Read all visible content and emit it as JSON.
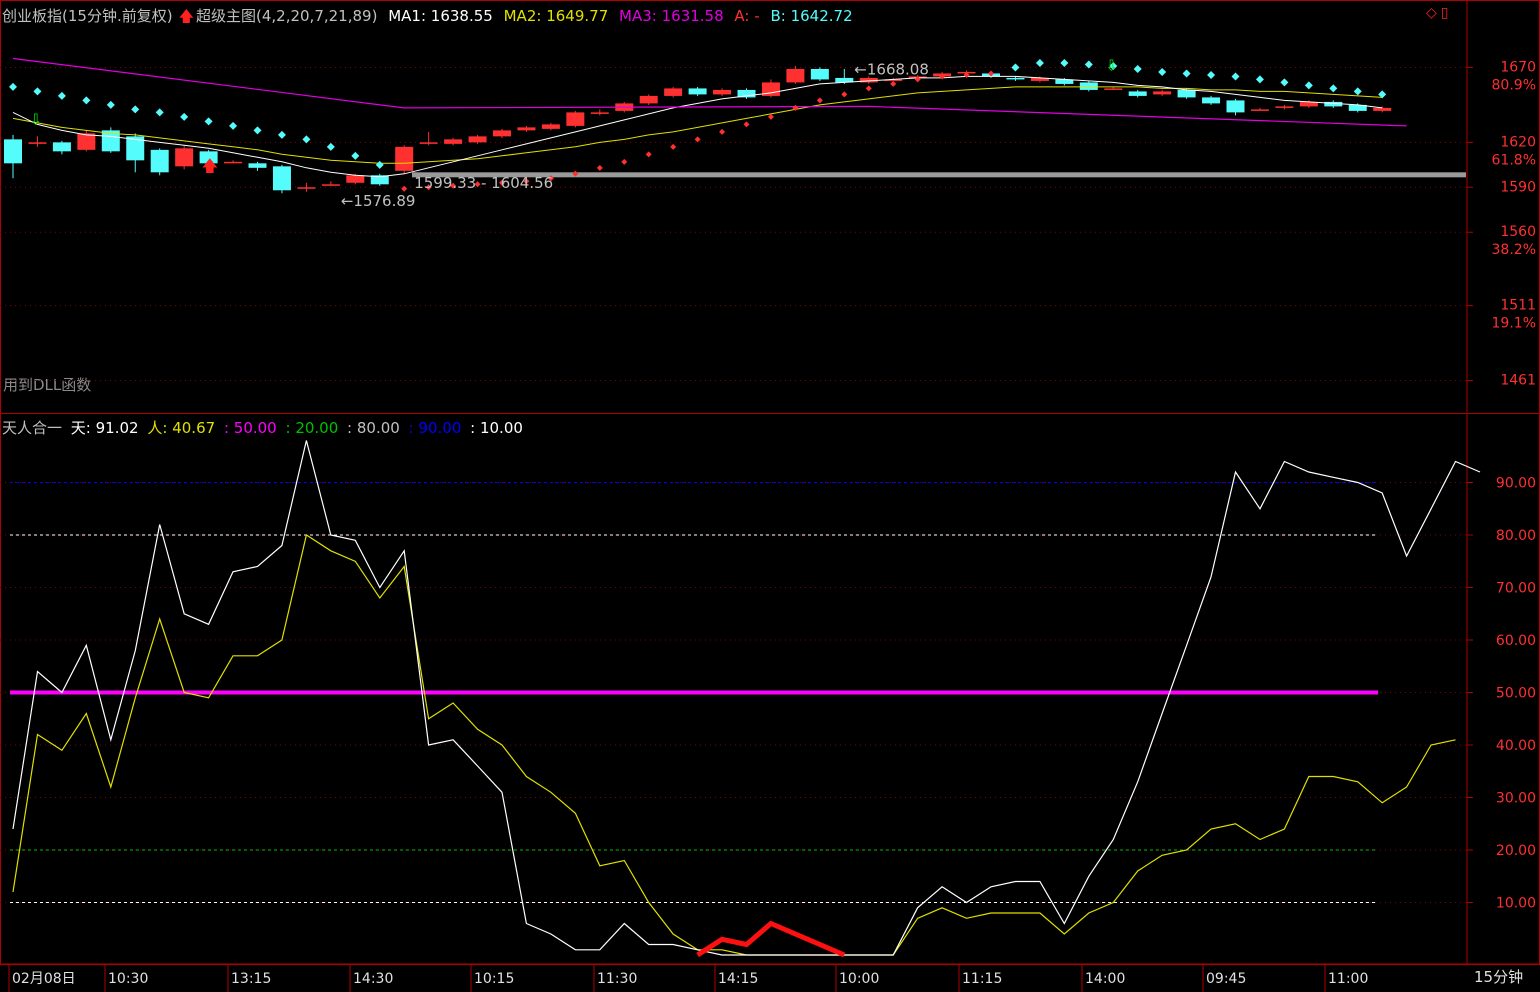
{
  "header": {
    "title": "创业板指(15分钟.前复权)",
    "indicator_name": "超级主图(4,2,20,7,21,89)",
    "ma1_label": "MA1:",
    "ma1_value": "1638.55",
    "ma2_label": "MA2:",
    "ma2_value": "1649.77",
    "ma3_label": "MA3:",
    "ma3_value": "1631.58",
    "a_label": "A: -",
    "b_label": "B:",
    "b_value": "1642.72"
  },
  "dll_note": "用到DLL函数",
  "indicator": {
    "name": "天人合一",
    "tian_label": "天:",
    "tian_value": "91.02",
    "ren_label": "人:",
    "ren_value": "40.67",
    "l50": ": 50.00",
    "l20": ": 20.00",
    "l80": ": 80.00",
    "l90": ": 90.00",
    "l10": ": 10.00"
  },
  "period_label": "15分钟",
  "corner_icons": [
    "diamond-icon",
    "window-icon"
  ],
  "colors": {
    "up": "#ff3030",
    "down": "#54fcfc",
    "ma1": "#ffffff",
    "ma2": "#e0e000",
    "ma3": "#e000e0",
    "tian": "#ffffff",
    "ren": "#e0e000",
    "l50": "#ff00ff",
    "l20": "#00c000",
    "l90": "#0000ff",
    "l80": "#ffffff",
    "l10": "#ffffff"
  },
  "chart_data": [
    {
      "type": "candlestick",
      "title": "创业板指(15分钟.前复权)",
      "ylim": [
        1440,
        1695
      ],
      "y_ticks": [
        {
          "value": 1670,
          "label": "1670",
          "pct": "80.9%"
        },
        {
          "value": 1620,
          "label": "1620",
          "pct": "61.8%"
        },
        {
          "value": 1590,
          "label": "1590",
          "pct": ""
        },
        {
          "value": 1560,
          "label": "1560",
          "pct": "38.2%"
        },
        {
          "value": 1511,
          "label": "1511",
          "pct": "19.1%"
        },
        {
          "value": 1461,
          "label": "1461",
          "pct": ""
        }
      ],
      "candles": [
        [
          1622,
          1606,
          1625,
          1596
        ],
        [
          1620,
          1620,
          1624,
          1617
        ],
        [
          1620,
          1614,
          1621,
          1612
        ],
        [
          1615,
          1626,
          1628,
          1614
        ],
        [
          1628,
          1614,
          1630,
          1613
        ],
        [
          1624,
          1608,
          1626,
          1600
        ],
        [
          1615,
          1600,
          1616,
          1598
        ],
        [
          1604,
          1616,
          1618,
          1602
        ],
        [
          1614,
          1606,
          1615,
          1605
        ],
        [
          1607,
          1607,
          1608,
          1606
        ],
        [
          1606,
          1603,
          1607,
          1601
        ],
        [
          1604,
          1588,
          1605,
          1586
        ],
        [
          1590,
          1590,
          1593,
          1587
        ],
        [
          1592,
          1592,
          1594,
          1591
        ],
        [
          1593,
          1598,
          1599,
          1592
        ],
        [
          1598,
          1592,
          1599,
          1591
        ],
        [
          1601,
          1617,
          1618,
          1599
        ],
        [
          1619,
          1620,
          1627,
          1618
        ],
        [
          1619,
          1622,
          1623,
          1618
        ],
        [
          1620,
          1624,
          1625,
          1619
        ],
        [
          1624,
          1628,
          1629,
          1623
        ],
        [
          1628,
          1630,
          1631,
          1627
        ],
        [
          1629,
          1632,
          1633,
          1628
        ],
        [
          1631,
          1640,
          1641,
          1630
        ],
        [
          1640,
          1640,
          1642,
          1638
        ],
        [
          1641,
          1646,
          1647,
          1640
        ],
        [
          1646,
          1651,
          1652,
          1645
        ],
        [
          1651,
          1656,
          1657,
          1650
        ],
        [
          1656,
          1652,
          1657,
          1651
        ],
        [
          1652,
          1655,
          1656,
          1651
        ],
        [
          1655,
          1650,
          1656,
          1649
        ],
        [
          1651,
          1660,
          1662,
          1650
        ],
        [
          1660,
          1669,
          1671,
          1659
        ],
        [
          1669,
          1662,
          1670,
          1661
        ],
        [
          1663,
          1660,
          1669,
          1659
        ],
        [
          1660,
          1663,
          1664,
          1659
        ],
        [
          1662,
          1662,
          1663,
          1661
        ],
        [
          1664,
          1664,
          1665,
          1663
        ],
        [
          1664,
          1666,
          1667,
          1663
        ],
        [
          1666,
          1667,
          1668,
          1665
        ],
        [
          1666,
          1664,
          1667,
          1663
        ],
        [
          1663,
          1662,
          1664,
          1661
        ],
        [
          1661,
          1663,
          1664,
          1660
        ],
        [
          1662,
          1659,
          1663,
          1658
        ],
        [
          1660,
          1655,
          1661,
          1654
        ],
        [
          1656,
          1656,
          1657,
          1655
        ],
        [
          1654,
          1651,
          1655,
          1650
        ],
        [
          1652,
          1654,
          1655,
          1651
        ],
        [
          1655,
          1650,
          1656,
          1649
        ],
        [
          1650,
          1646,
          1651,
          1645
        ],
        [
          1648,
          1640,
          1649,
          1638
        ],
        [
          1642,
          1642,
          1643,
          1641
        ],
        [
          1643,
          1644,
          1645,
          1642
        ],
        [
          1644,
          1647,
          1648,
          1643
        ],
        [
          1647,
          1644,
          1648,
          1643
        ],
        [
          1645,
          1641,
          1646,
          1640
        ],
        [
          1641,
          1643,
          1644,
          1640
        ]
      ],
      "ma1": [
        1640,
        1632,
        1628,
        1625,
        1624,
        1622,
        1620,
        1618,
        1616,
        1613,
        1610,
        1607,
        1603,
        1600,
        1598,
        1597,
        1599,
        1603,
        1607,
        1611,
        1615,
        1619,
        1623,
        1627,
        1631,
        1635,
        1639,
        1643,
        1646,
        1649,
        1651,
        1653,
        1656,
        1659,
        1660,
        1661,
        1662,
        1663,
        1663,
        1664,
        1664,
        1664,
        1663,
        1662,
        1661,
        1660,
        1658,
        1657,
        1655,
        1654,
        1652,
        1650,
        1648,
        1647,
        1646,
        1645,
        1643
      ],
      "ma2": [
        1636,
        1633,
        1630,
        1628,
        1626,
        1625,
        1623,
        1621,
        1619,
        1617,
        1615,
        1612,
        1610,
        1608,
        1607,
        1606,
        1606,
        1607,
        1608,
        1609,
        1611,
        1613,
        1615,
        1617,
        1620,
        1622,
        1625,
        1627,
        1630,
        1633,
        1636,
        1639,
        1642,
        1645,
        1647,
        1649,
        1651,
        1653,
        1654,
        1655,
        1656,
        1657,
        1657,
        1657,
        1657,
        1657,
        1657,
        1656,
        1656,
        1655,
        1655,
        1654,
        1654,
        1653,
        1652,
        1651,
        1650
      ],
      "ma3_line": [
        [
          0,
          1676
        ],
        [
          16,
          1643
        ],
        [
          35,
          1644
        ],
        [
          57,
          1631
        ]
      ],
      "sar": [
        [
          1657,
          "b"
        ],
        [
          1654,
          "b"
        ],
        [
          1651,
          "b"
        ],
        [
          1648,
          "b"
        ],
        [
          1645,
          "b"
        ],
        [
          1642,
          "b"
        ],
        [
          1640,
          "b"
        ],
        [
          1637,
          "b"
        ],
        [
          1634,
          "b"
        ],
        [
          1631,
          "b"
        ],
        [
          1628,
          "b"
        ],
        [
          1625,
          "b"
        ],
        [
          1622,
          "b"
        ],
        [
          1617,
          "b"
        ],
        [
          1611,
          "b"
        ],
        [
          1605,
          "b"
        ],
        [
          1589,
          "r"
        ],
        [
          1590,
          "r"
        ],
        [
          1591,
          "r"
        ],
        [
          1592,
          "r"
        ],
        [
          1593,
          "r"
        ],
        [
          1594,
          "r"
        ],
        [
          1596,
          "r"
        ],
        [
          1599,
          "r"
        ],
        [
          1603,
          "r"
        ],
        [
          1607,
          "r"
        ],
        [
          1612,
          "r"
        ],
        [
          1617,
          "r"
        ],
        [
          1622,
          "r"
        ],
        [
          1627,
          "r"
        ],
        [
          1632,
          "r"
        ],
        [
          1637,
          "r"
        ],
        [
          1643,
          "r"
        ],
        [
          1648,
          "r"
        ],
        [
          1652,
          "r"
        ],
        [
          1656,
          "r"
        ],
        [
          1659,
          "r"
        ],
        [
          1662,
          "r"
        ],
        [
          1664,
          "r"
        ],
        [
          1665,
          "r"
        ],
        [
          1666,
          "r"
        ],
        [
          1670,
          "b"
        ],
        [
          1673,
          "b"
        ],
        [
          1673,
          "b"
        ],
        [
          1672,
          "b"
        ],
        [
          1671,
          "b"
        ],
        [
          1669,
          "b"
        ],
        [
          1667,
          "b"
        ],
        [
          1666,
          "b"
        ],
        [
          1665,
          "b"
        ],
        [
          1664,
          "b"
        ],
        [
          1662,
          "b"
        ],
        [
          1660,
          "b"
        ],
        [
          1658,
          "b"
        ],
        [
          1656,
          "b"
        ],
        [
          1654,
          "b"
        ],
        [
          1652,
          "b"
        ]
      ],
      "support_band": 1598,
      "annotations": [
        {
          "text": "1668.08",
          "index": 34,
          "price": 1668
        },
        {
          "text": "1599.33 - 1604.56",
          "index": 16,
          "price": 1599
        },
        {
          "text": "1576.89",
          "index": 13,
          "price": 1587
        }
      ]
    },
    {
      "type": "line",
      "name": "天人合一",
      "ylim": [
        0,
        100
      ],
      "y_ticks": [
        "90.00",
        "80.00",
        "70.00",
        "60.00",
        "50.00",
        "40.00",
        "30.00",
        "20.00",
        "10.00"
      ],
      "x_labels": [
        "02月08日",
        "10:30",
        "13:15",
        "14:30",
        "10:15",
        "11:30",
        "14:15",
        "10:00",
        "11:15",
        "14:00",
        "09:45",
        "11:00"
      ],
      "series": [
        {
          "name": "天",
          "values": [
            24,
            54,
            50,
            59,
            41,
            58,
            82,
            65,
            63,
            73,
            74,
            78,
            98,
            80,
            79,
            70,
            77,
            40,
            41,
            36,
            31,
            6,
            4,
            1,
            1,
            6,
            2,
            2,
            1,
            0,
            0,
            0,
            0,
            0,
            0,
            0,
            0,
            9,
            13,
            10,
            13,
            14,
            14,
            6,
            15,
            22,
            33,
            46,
            59,
            72,
            92,
            85,
            94,
            92,
            91,
            90,
            88,
            76,
            85,
            94,
            92
          ]
        },
        {
          "name": "人",
          "values": [
            12,
            42,
            39,
            46,
            32,
            49,
            64,
            50,
            49,
            57,
            57,
            60,
            80,
            77,
            75,
            68,
            74,
            45,
            48,
            43,
            40,
            34,
            31,
            27,
            17,
            18,
            10,
            4,
            1,
            1,
            0,
            0,
            0,
            0,
            0,
            0,
            0,
            7,
            9,
            7,
            8,
            8,
            8,
            4,
            8,
            10,
            16,
            19,
            20,
            24,
            25,
            22,
            24,
            34,
            34,
            33,
            29,
            32,
            40,
            41
          ]
        },
        {
          "name": "red",
          "values": [
            0,
            3,
            2,
            6,
            4,
            2,
            0
          ]
        }
      ],
      "levels": [
        90,
        80,
        50,
        20,
        10
      ]
    }
  ]
}
